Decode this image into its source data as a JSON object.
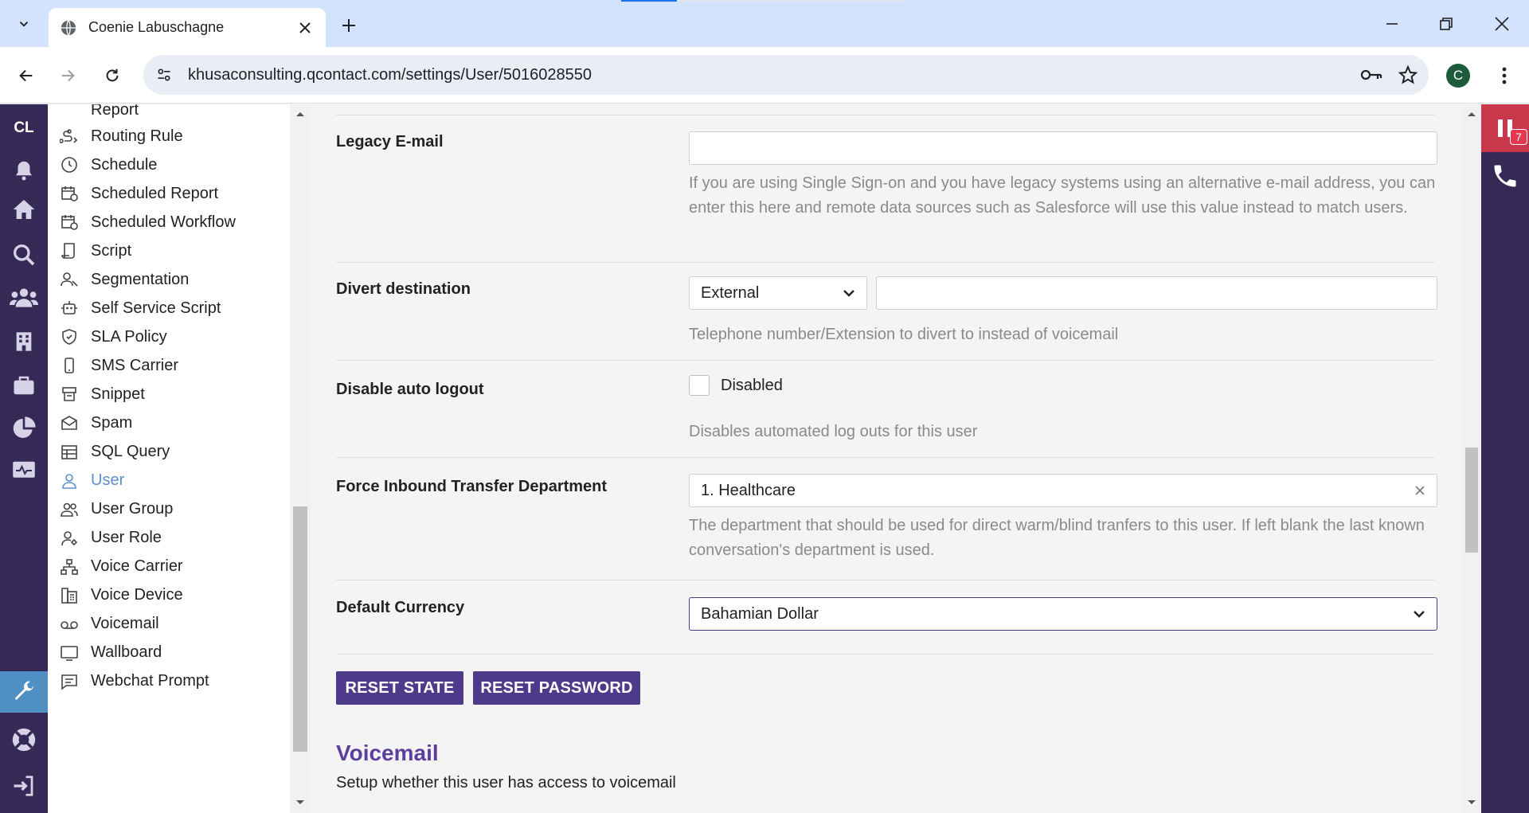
{
  "browser": {
    "tab_title": "Coenie Labuschagne",
    "url": "khusaconsulting.qcontact.com/settings/User/5016028550",
    "profile_initial": "C"
  },
  "rail": {
    "user_initials": "CL",
    "items": [
      "bell-icon",
      "home-icon",
      "search-icon",
      "users-icon",
      "building-icon",
      "briefcase-icon",
      "pie-chart-icon",
      "monitor-icon",
      "wrench-icon",
      "lifebuoy-icon",
      "logout-icon"
    ]
  },
  "sidebar": {
    "partial_top": "Report",
    "items": [
      {
        "label": "Routing Rule",
        "icon": "routing-icon"
      },
      {
        "label": "Schedule",
        "icon": "clock-icon"
      },
      {
        "label": "Scheduled Report",
        "icon": "calendar-clock-icon"
      },
      {
        "label": "Scheduled Workflow",
        "icon": "calendar-clock-icon"
      },
      {
        "label": "Script",
        "icon": "script-icon"
      },
      {
        "label": "Segmentation",
        "icon": "segmentation-icon"
      },
      {
        "label": "Self Service Script",
        "icon": "robot-icon"
      },
      {
        "label": "SLA Policy",
        "icon": "sla-icon"
      },
      {
        "label": "SMS Carrier",
        "icon": "mobile-icon"
      },
      {
        "label": "Snippet",
        "icon": "snippet-icon"
      },
      {
        "label": "Spam",
        "icon": "spam-icon"
      },
      {
        "label": "SQL Query",
        "icon": "table-icon"
      },
      {
        "label": "User",
        "icon": "user-icon",
        "active": true
      },
      {
        "label": "User Group",
        "icon": "user-group-icon"
      },
      {
        "label": "User Role",
        "icon": "user-role-icon"
      },
      {
        "label": "Voice Carrier",
        "icon": "network-icon"
      },
      {
        "label": "Voice Device",
        "icon": "fax-icon"
      },
      {
        "label": "Voicemail",
        "icon": "voicemail-icon"
      },
      {
        "label": "Wallboard",
        "icon": "wallboard-icon"
      },
      {
        "label": "Webchat Prompt",
        "icon": "chat-icon"
      }
    ]
  },
  "form": {
    "legacy_email": {
      "label": "Legacy E-mail",
      "value": "",
      "help": "If you are using Single Sign-on and you have legacy systems using an alternative e-mail address, you can enter this here and remote data sources such as Salesforce will use this value instead to match users."
    },
    "divert": {
      "label": "Divert destination",
      "type_value": "External",
      "value": "",
      "help": "Telephone number/Extension to divert to instead of voicemail"
    },
    "auto_logout": {
      "label": "Disable auto logout",
      "checkbox_label": "Disabled",
      "checked": false,
      "help": "Disables automated log outs for this user"
    },
    "force_transfer": {
      "label": "Force Inbound Transfer Department",
      "value": "1. Healthcare",
      "help": "The department that should be used for direct warm/blind tranfers to this user. If left blank the last known conversation's department is used."
    },
    "currency": {
      "label": "Default Currency",
      "value": "Bahamian Dollar"
    }
  },
  "buttons": {
    "reset_state": "RESET STATE",
    "reset_password": "RESET PASSWORD"
  },
  "voicemail_section": {
    "title": "Voicemail",
    "subtitle": "Setup whether this user has access to voicemail"
  },
  "dock": {
    "queue_count": "7"
  },
  "colors": {
    "rail": "#352a56",
    "primary_button": "#4e3a8a",
    "section_title": "#5b3f9e",
    "active_link": "#5b8fd0",
    "dock_alert": "#c8384a"
  }
}
